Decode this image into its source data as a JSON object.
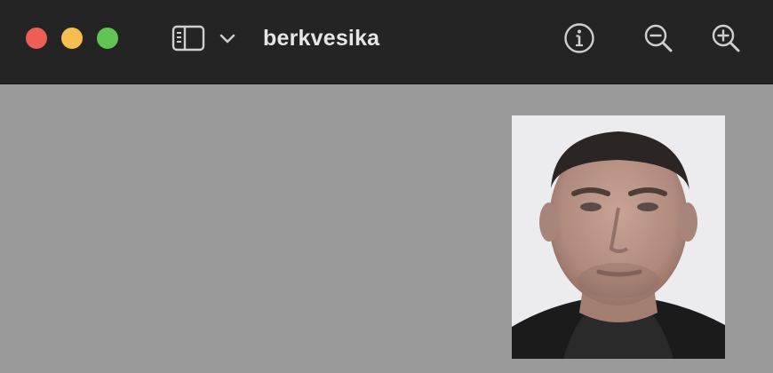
{
  "window": {
    "title": "berkvesika",
    "traffic_lights": {
      "close": "#ec5f57",
      "minimize": "#f4bf4f",
      "zoom": "#61c554"
    }
  },
  "toolbar": {
    "icons": [
      "sidebar-icon",
      "chevron-down-icon",
      "info-icon",
      "zoom-out-icon",
      "zoom-in-icon"
    ]
  },
  "colors": {
    "titlebar": "#242424",
    "canvas": "#9a9a9a",
    "icon": "#cfcfcf"
  }
}
